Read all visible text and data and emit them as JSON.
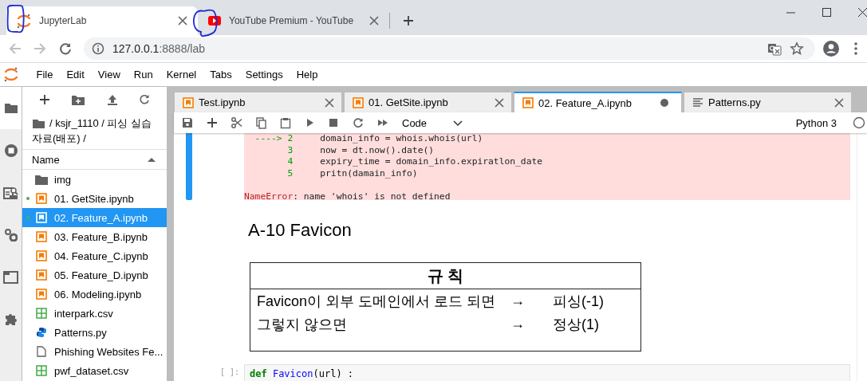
{
  "browser": {
    "tabs": [
      {
        "title": "JupyterLab",
        "selected": true
      },
      {
        "title": "YouTube Premium - YouTube",
        "selected": false
      }
    ],
    "url_host": "127.0.0.1",
    "url_path": ":8888/lab"
  },
  "menu": [
    "File",
    "Edit",
    "View",
    "Run",
    "Kernel",
    "Tabs",
    "Settings",
    "Help"
  ],
  "file_browser": {
    "path": "/ ksjr_1110 / 피싱 실습 자료(배포) /",
    "column": "Name",
    "items": [
      {
        "name": "img",
        "kind": "folder",
        "running": false,
        "selected": false
      },
      {
        "name": "01. GetSite.ipynb",
        "kind": "notebook",
        "running": true,
        "selected": false
      },
      {
        "name": "02. Feature_A.ipynb",
        "kind": "notebook",
        "running": true,
        "selected": true
      },
      {
        "name": "03. Feature_B.ipynb",
        "kind": "notebook",
        "running": false,
        "selected": false
      },
      {
        "name": "04. Feature_C.ipynb",
        "kind": "notebook",
        "running": false,
        "selected": false
      },
      {
        "name": "05. Feature_D.ipynb",
        "kind": "notebook",
        "running": false,
        "selected": false
      },
      {
        "name": "06. Modeling.ipynb",
        "kind": "notebook",
        "running": false,
        "selected": false
      },
      {
        "name": "interpark.csv",
        "kind": "csv",
        "running": false,
        "selected": false
      },
      {
        "name": "Patterns.py",
        "kind": "python",
        "running": false,
        "selected": false
      },
      {
        "name": "Phishing Websites Fe...",
        "kind": "file",
        "running": false,
        "selected": false
      },
      {
        "name": "pwf_dataset.csv",
        "kind": "csv",
        "running": false,
        "selected": false
      }
    ]
  },
  "editor_tabs": [
    {
      "title": "Test.ipynb",
      "kind": "notebook",
      "selected": false,
      "dirty": false
    },
    {
      "title": "01. GetSite.ipynb",
      "kind": "notebook",
      "selected": false,
      "dirty": false
    },
    {
      "title": "02. Feature_A.ipynb",
      "kind": "notebook",
      "selected": true,
      "dirty": true
    },
    {
      "title": "Patterns.py",
      "kind": "text",
      "selected": false,
      "dirty": false
    }
  ],
  "toolbar": {
    "cell_type": "Code",
    "kernel": "Python 3"
  },
  "output": {
    "lines": [
      {
        "marker": "---->",
        "number": "2",
        "code": "domain_info = whois.whois(url)"
      },
      {
        "number": "3",
        "code": "now = dt.now().date()"
      },
      {
        "number": "4",
        "code": "expiry_time = domain_info.expiratlon_date"
      },
      {
        "number": "5",
        "code": "pritn(damain_info)"
      }
    ],
    "error_name": "NameError",
    "error_message": ": name 'whois' is not defined"
  },
  "heading": "A-10 Favicon",
  "rule_table": {
    "header": "규 칙",
    "rows": [
      {
        "condition": "Favicon이 외부 도메인에서 로드 되면",
        "arrow": "→",
        "result": "피싱(-1)"
      },
      {
        "condition": "그렇지 않으면",
        "arrow": "→",
        "result": "정상(1)"
      }
    ]
  },
  "code_cell": {
    "prompt": "[ ]:",
    "tokens": [
      {
        "kind": "keyword",
        "text": "def"
      },
      {
        "kind": "function",
        "text": " Favicon"
      },
      {
        "kind": "plain",
        "text": "(url) :"
      }
    ]
  }
}
